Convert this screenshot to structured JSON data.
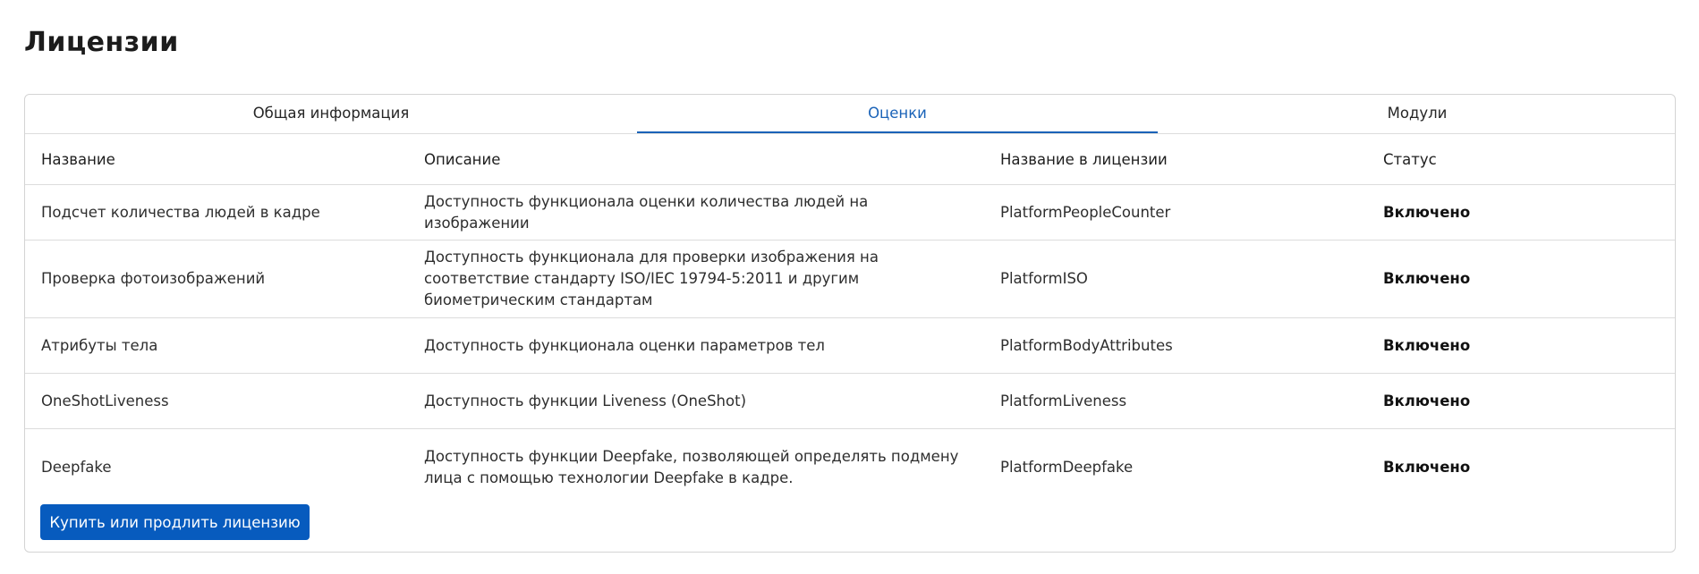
{
  "page": {
    "title": "Лицензии"
  },
  "tabs": [
    {
      "label": "Общая информация",
      "active": false
    },
    {
      "label": "Оценки",
      "active": true
    },
    {
      "label": "Модули",
      "active": false
    }
  ],
  "table": {
    "headers": [
      "Название",
      "Описание",
      "Название в лицензии",
      "Статус"
    ],
    "rows": [
      {
        "name": "Подсчет количества людей в кадре",
        "description": "Доступность функционала оценки количества людей на изображении",
        "license_name": "PlatformPeopleCounter",
        "status": "Включено"
      },
      {
        "name": "Проверка фотоизображений",
        "description": "Доступность функционала для проверки изображения на соответствие стандарту ISO/IEC 19794-5:2011 и другим биометрическим стандартам",
        "license_name": "PlatformISO",
        "status": "Включено"
      },
      {
        "name": "Атрибуты тела",
        "description": "Доступность функционала оценки параметров тел",
        "license_name": "PlatformBodyAttributes",
        "status": "Включено"
      },
      {
        "name": "OneShotLiveness",
        "description": "Доступность функции Liveness (OneShot)",
        "license_name": "PlatformLiveness",
        "status": "Включено"
      },
      {
        "name": "Deepfake",
        "description": "Доступность функции Deepfake, позволяющей определять подмену лица с помощью технологии Deepfake в кадре.",
        "license_name": "PlatformDeepfake",
        "status": "Включено"
      }
    ]
  },
  "actions": {
    "buy_label": "Купить или продлить лицензию"
  },
  "colors": {
    "accent": "#1a63b8",
    "button": "#075bbe"
  }
}
